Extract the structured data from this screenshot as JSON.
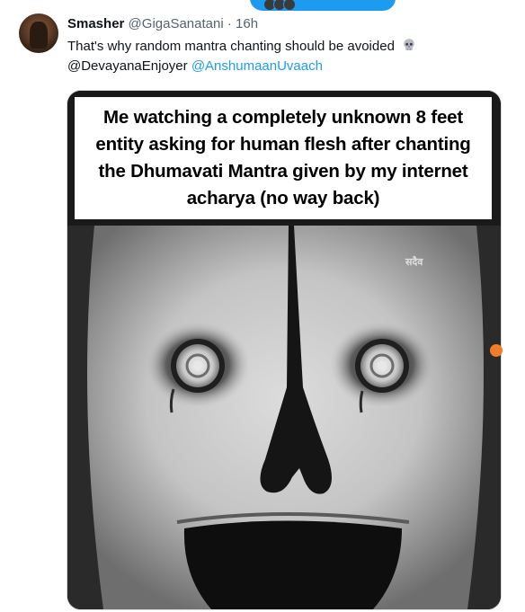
{
  "tweet": {
    "display_name": "Smasher",
    "handle": "@GigaSanatani",
    "separator": "·",
    "time": "16h",
    "text": "That's why random mantra chanting should be avoided",
    "emoji_icon": "skull-icon",
    "mention_plain": "@DevayanaEnjoyer",
    "mention_link": "@AnshumaanUvaach"
  },
  "media": {
    "caption": "Me watching a completely unknown 8 feet entity asking for human flesh after chanting the Dhumavati Mantra given by my internet acharya (no way back)",
    "watermark": "सदैव"
  },
  "colors": {
    "accent": "#1d9bf0",
    "text": "#0f1419",
    "muted": "#536471",
    "border": "#cfd9de",
    "side_tab": "#f07d2a"
  }
}
